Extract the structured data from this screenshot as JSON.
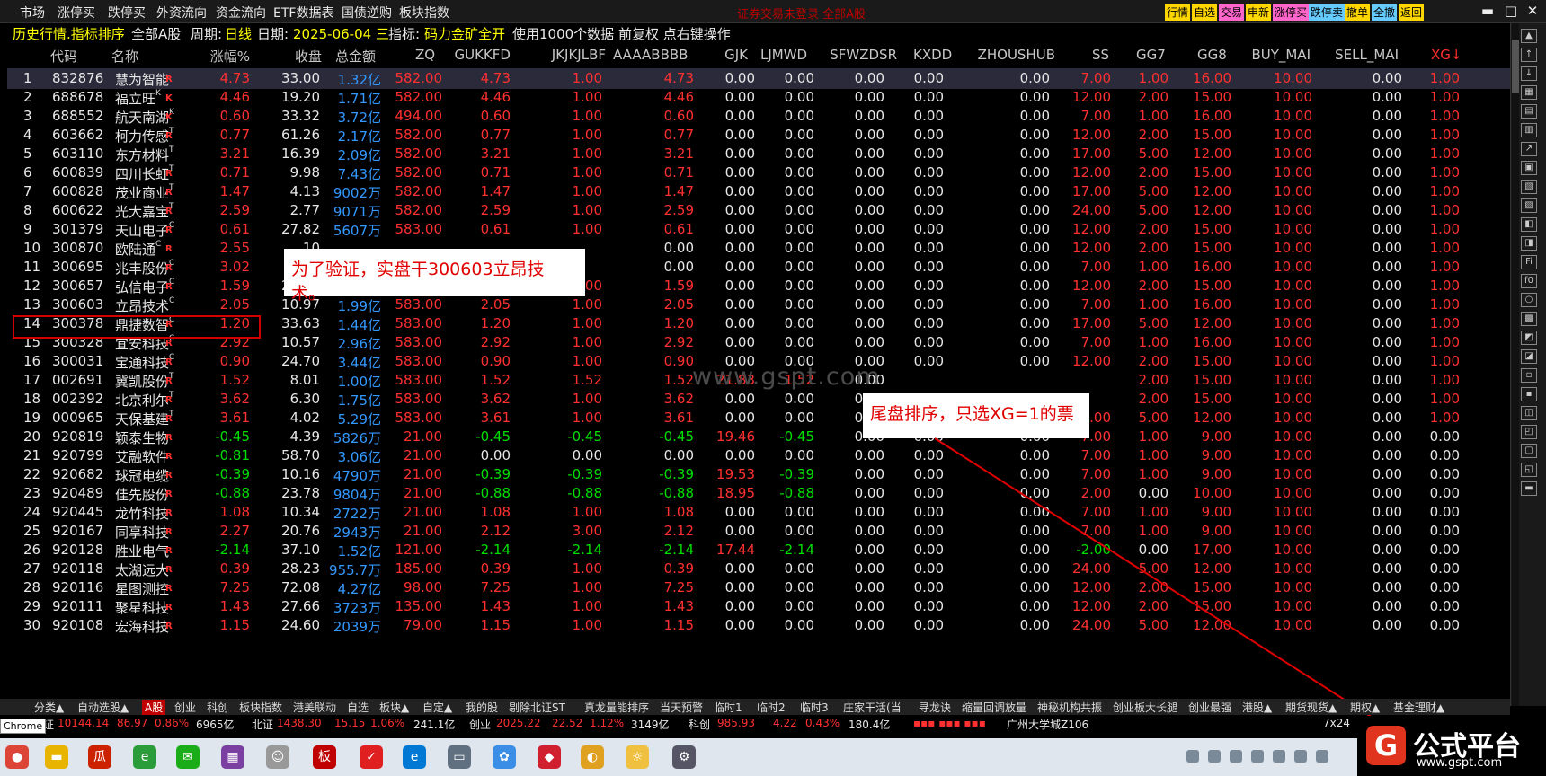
{
  "menu": [
    "市场",
    "涨停买",
    "跌停买",
    "外资流向",
    "资金流向",
    "ETF数据表",
    "国债逆购",
    "板块指数"
  ],
  "warning": "证券交易未登录  全部A股",
  "quick_buttons": [
    {
      "label": "行情",
      "color": "#ffd700"
    },
    {
      "label": "自选",
      "color": "#ffd700"
    },
    {
      "label": "交易",
      "color": "#ff66cc"
    },
    {
      "label": "申新",
      "color": "#ffd700"
    },
    {
      "label": "涨停买",
      "color": "#ff66cc"
    },
    {
      "label": "跌停卖",
      "color": "#66ccff"
    },
    {
      "label": "撤单",
      "color": "#ffd700"
    },
    {
      "label": "全撤",
      "color": "#66ccff"
    },
    {
      "label": "返回",
      "color": "#ffd700"
    }
  ],
  "window_controls": [
    "▬",
    "□",
    "✕"
  ],
  "info": {
    "section": "历史行情.指标排序",
    "market": "全部A股",
    "period_label": "周期:",
    "period": "日线",
    "date_label": "日期:",
    "date": "2025-06-04 三",
    "indicator_label": "指标:",
    "indicator": "码力金矿全开",
    "extra": "使用1000个数据 前复权 点右键操作"
  },
  "columns": [
    "代码",
    "名称",
    "涨幅%",
    "收盘",
    "总金额",
    "ZQ",
    "GUKKFD",
    "JKJKJLBF",
    "AAAABBBB",
    "GJK",
    "LJMWD",
    "SFWZDSR",
    "KXDD",
    "ZHOUSHUB",
    "SS",
    "GG7",
    "GG8",
    "BUY_MAI",
    "SELL_MAI",
    "XG↓"
  ],
  "rows": [
    {
      "n": "1",
      "code": "832876",
      "name": "慧为智能",
      "sup": "",
      "tag": "R",
      "chg": "4.73",
      "close": "33.00",
      "amt": "1.32亿",
      "zq": "582.00",
      "gukkfd": "4.73",
      "jk": "1.00",
      "aa": "4.73",
      "gjk": "0.00",
      "lj": "0.00",
      "sf": "0.00",
      "kx": "0.00",
      "zh": "0.00",
      "ss": "7.00",
      "gg7": "1.00",
      "gg8": "16.00",
      "buy": "10.00",
      "sell": "0.00",
      "xg": "1.00"
    },
    {
      "n": "2",
      "code": "688678",
      "name": "福立旺",
      "sup": "K",
      "tag": "K",
      "chg": "4.46",
      "close": "19.20",
      "amt": "1.71亿",
      "zq": "582.00",
      "gukkfd": "4.46",
      "jk": "1.00",
      "aa": "4.46",
      "gjk": "0.00",
      "lj": "0.00",
      "sf": "0.00",
      "kx": "0.00",
      "zh": "0.00",
      "ss": "12.00",
      "gg7": "2.00",
      "gg8": "15.00",
      "buy": "10.00",
      "sell": "0.00",
      "xg": "1.00"
    },
    {
      "n": "3",
      "code": "688552",
      "name": "航天南湖",
      "sup": "K",
      "tag": "K",
      "chg": "0.60",
      "close": "33.32",
      "amt": "3.72亿",
      "zq": "494.00",
      "gukkfd": "0.60",
      "jk": "1.00",
      "aa": "0.60",
      "gjk": "0.00",
      "lj": "0.00",
      "sf": "0.00",
      "kx": "0.00",
      "zh": "0.00",
      "ss": "7.00",
      "gg7": "1.00",
      "gg8": "16.00",
      "buy": "10.00",
      "sell": "0.00",
      "xg": "1.00"
    },
    {
      "n": "4",
      "code": "603662",
      "name": "柯力传感",
      "sup": "T",
      "tag": "R",
      "chg": "0.77",
      "close": "61.26",
      "amt": "2.17亿",
      "zq": "582.00",
      "gukkfd": "0.77",
      "jk": "1.00",
      "aa": "0.77",
      "gjk": "0.00",
      "lj": "0.00",
      "sf": "0.00",
      "kx": "0.00",
      "zh": "0.00",
      "ss": "12.00",
      "gg7": "2.00",
      "gg8": "15.00",
      "buy": "10.00",
      "sell": "0.00",
      "xg": "1.00"
    },
    {
      "n": "5",
      "code": "603110",
      "name": "东方材料",
      "sup": "T",
      "tag": "",
      "chg": "3.21",
      "close": "16.39",
      "amt": "2.09亿",
      "zq": "582.00",
      "gukkfd": "3.21",
      "jk": "1.00",
      "aa": "3.21",
      "gjk": "0.00",
      "lj": "0.00",
      "sf": "0.00",
      "kx": "0.00",
      "zh": "0.00",
      "ss": "17.00",
      "gg7": "5.00",
      "gg8": "12.00",
      "buy": "10.00",
      "sell": "0.00",
      "xg": "1.00"
    },
    {
      "n": "6",
      "code": "600839",
      "name": "四川长虹",
      "sup": "T",
      "tag": "R",
      "chg": "0.71",
      "close": "9.98",
      "amt": "7.43亿",
      "zq": "582.00",
      "gukkfd": "0.71",
      "jk": "1.00",
      "aa": "0.71",
      "gjk": "0.00",
      "lj": "0.00",
      "sf": "0.00",
      "kx": "0.00",
      "zh": "0.00",
      "ss": "12.00",
      "gg7": "2.00",
      "gg8": "15.00",
      "buy": "10.00",
      "sell": "0.00",
      "xg": "1.00"
    },
    {
      "n": "7",
      "code": "600828",
      "name": "茂业商业",
      "sup": "T",
      "tag": "R",
      "chg": "1.47",
      "close": "4.13",
      "amt": "9002万",
      "zq": "582.00",
      "gukkfd": "1.47",
      "jk": "1.00",
      "aa": "1.47",
      "gjk": "0.00",
      "lj": "0.00",
      "sf": "0.00",
      "kx": "0.00",
      "zh": "0.00",
      "ss": "17.00",
      "gg7": "5.00",
      "gg8": "12.00",
      "buy": "10.00",
      "sell": "0.00",
      "xg": "1.00"
    },
    {
      "n": "8",
      "code": "600622",
      "name": "光大嘉宝",
      "sup": "T",
      "tag": "R",
      "chg": "2.59",
      "close": "2.77",
      "amt": "9071万",
      "zq": "582.00",
      "gukkfd": "2.59",
      "jk": "1.00",
      "aa": "2.59",
      "gjk": "0.00",
      "lj": "0.00",
      "sf": "0.00",
      "kx": "0.00",
      "zh": "0.00",
      "ss": "24.00",
      "gg7": "5.00",
      "gg8": "12.00",
      "buy": "10.00",
      "sell": "0.00",
      "xg": "1.00"
    },
    {
      "n": "9",
      "code": "301379",
      "name": "天山电子",
      "sup": "C",
      "tag": "R",
      "chg": "0.61",
      "close": "27.82",
      "amt": "5607万",
      "zq": "583.00",
      "gukkfd": "0.61",
      "jk": "1.00",
      "aa": "0.61",
      "gjk": "0.00",
      "lj": "0.00",
      "sf": "0.00",
      "kx": "0.00",
      "zh": "0.00",
      "ss": "12.00",
      "gg7": "2.00",
      "gg8": "15.00",
      "buy": "10.00",
      "sell": "0.00",
      "xg": "1.00"
    },
    {
      "n": "10",
      "code": "300870",
      "name": "欧陆通",
      "sup": "C",
      "tag": "R",
      "chg": "2.55",
      "close": "10",
      "amt": "",
      "zq": "",
      "gukkfd": "",
      "jk": "",
      "aa": "0.00",
      "gjk": "0.00",
      "lj": "0.00",
      "sf": "0.00",
      "kx": "0.00",
      "zh": "0.00",
      "ss": "12.00",
      "gg7": "2.00",
      "gg8": "15.00",
      "buy": "10.00",
      "sell": "0.00",
      "xg": "1.00"
    },
    {
      "n": "11",
      "code": "300695",
      "name": "兆丰股份",
      "sup": "C",
      "tag": "R",
      "chg": "3.02",
      "close": "8",
      "amt": "",
      "zq": "",
      "gukkfd": "",
      "jk": "",
      "aa": "0.00",
      "gjk": "0.00",
      "lj": "0.00",
      "sf": "0.00",
      "kx": "0.00",
      "zh": "0.00",
      "ss": "7.00",
      "gg7": "1.00",
      "gg8": "16.00",
      "buy": "10.00",
      "sell": "0.00",
      "xg": "1.00"
    },
    {
      "n": "12",
      "code": "300657",
      "name": "弘信电子",
      "sup": "C",
      "tag": "R",
      "chg": "1.59",
      "close": "25.56",
      "amt": "3.88亿",
      "zq": "583.00",
      "gukkfd": "1.59",
      "jk": "1.00",
      "aa": "1.59",
      "gjk": "0.00",
      "lj": "0.00",
      "sf": "0.00",
      "kx": "0.00",
      "zh": "0.00",
      "ss": "12.00",
      "gg7": "2.00",
      "gg8": "15.00",
      "buy": "10.00",
      "sell": "0.00",
      "xg": "1.00"
    },
    {
      "n": "13",
      "code": "300603",
      "name": "立昂技术",
      "sup": "C",
      "tag": "",
      "chg": "2.05",
      "close": "10.97",
      "amt": "1.99亿",
      "zq": "583.00",
      "gukkfd": "2.05",
      "jk": "1.00",
      "aa": "2.05",
      "gjk": "0.00",
      "lj": "0.00",
      "sf": "0.00",
      "kx": "0.00",
      "zh": "0.00",
      "ss": "7.00",
      "gg7": "1.00",
      "gg8": "16.00",
      "buy": "10.00",
      "sell": "0.00",
      "xg": "1.00"
    },
    {
      "n": "14",
      "code": "300378",
      "name": "鼎捷数智",
      "sup": "C",
      "tag": "R",
      "chg": "1.20",
      "close": "33.63",
      "amt": "1.44亿",
      "zq": "583.00",
      "gukkfd": "1.20",
      "jk": "1.00",
      "aa": "1.20",
      "gjk": "0.00",
      "lj": "0.00",
      "sf": "0.00",
      "kx": "0.00",
      "zh": "0.00",
      "ss": "17.00",
      "gg7": "5.00",
      "gg8": "12.00",
      "buy": "10.00",
      "sell": "0.00",
      "xg": "1.00"
    },
    {
      "n": "15",
      "code": "300328",
      "name": "宜安科技",
      "sup": "C",
      "tag": "R",
      "chg": "2.92",
      "close": "10.57",
      "amt": "2.96亿",
      "zq": "583.00",
      "gukkfd": "2.92",
      "jk": "1.00",
      "aa": "2.92",
      "gjk": "0.00",
      "lj": "0.00",
      "sf": "0.00",
      "kx": "0.00",
      "zh": "0.00",
      "ss": "7.00",
      "gg7": "1.00",
      "gg8": "16.00",
      "buy": "10.00",
      "sell": "0.00",
      "xg": "1.00"
    },
    {
      "n": "16",
      "code": "300031",
      "name": "宝通科技",
      "sup": "C",
      "tag": "R",
      "chg": "0.90",
      "close": "24.70",
      "amt": "3.44亿",
      "zq": "583.00",
      "gukkfd": "0.90",
      "jk": "1.00",
      "aa": "0.90",
      "gjk": "0.00",
      "lj": "0.00",
      "sf": "0.00",
      "kx": "0.00",
      "zh": "0.00",
      "ss": "12.00",
      "gg7": "2.00",
      "gg8": "15.00",
      "buy": "10.00",
      "sell": "0.00",
      "xg": "1.00"
    },
    {
      "n": "17",
      "code": "002691",
      "name": "冀凯股份",
      "sup": "T",
      "tag": "R",
      "chg": "1.52",
      "close": "8.01",
      "amt": "1.00亿",
      "zq": "583.00",
      "gukkfd": "1.52",
      "jk": "1.52",
      "aa": "1.52",
      "gjk": "21.83",
      "lj": "1.52",
      "sf": "0.00",
      "kx": "",
      "zh": "",
      "ss": "",
      "gg7": "2.00",
      "gg8": "15.00",
      "buy": "10.00",
      "sell": "0.00",
      "xg": "1.00"
    },
    {
      "n": "18",
      "code": "002392",
      "name": "北京利尔",
      "sup": "T",
      "tag": "R",
      "chg": "3.62",
      "close": "6.30",
      "amt": "1.75亿",
      "zq": "583.00",
      "gukkfd": "3.62",
      "jk": "1.00",
      "aa": "3.62",
      "gjk": "0.00",
      "lj": "0.00",
      "sf": "0.00",
      "kx": "",
      "zh": "",
      "ss": "",
      "gg7": "2.00",
      "gg8": "15.00",
      "buy": "10.00",
      "sell": "0.00",
      "xg": "1.00"
    },
    {
      "n": "19",
      "code": "000965",
      "name": "天保基建",
      "sup": "T",
      "tag": "R",
      "chg": "3.61",
      "close": "4.02",
      "amt": "5.29亿",
      "zq": "583.00",
      "gukkfd": "3.61",
      "jk": "1.00",
      "aa": "3.61",
      "gjk": "0.00",
      "lj": "0.00",
      "sf": "0.00",
      "kx": "0.00",
      "zh": "0.00",
      "ss": "19.00",
      "gg7": "5.00",
      "gg8": "12.00",
      "buy": "10.00",
      "sell": "0.00",
      "xg": "1.00"
    },
    {
      "n": "20",
      "code": "920819",
      "name": "颖泰生物",
      "sup": "",
      "tag": "R",
      "chg": "-0.45",
      "close": "4.39",
      "amt": "5826万",
      "zq": "21.00",
      "gukkfd": "-0.45",
      "jk": "-0.45",
      "aa": "-0.45",
      "gjk": "19.46",
      "lj": "-0.45",
      "sf": "0.00",
      "kx": "0.00",
      "zh": "0.00",
      "ss": "7.00",
      "gg7": "1.00",
      "gg8": "9.00",
      "buy": "10.00",
      "sell": "0.00",
      "xg": "0.00"
    },
    {
      "n": "21",
      "code": "920799",
      "name": "艾融软件",
      "sup": "",
      "tag": "R",
      "chg": "-0.81",
      "close": "58.70",
      "amt": "3.06亿",
      "zq": "21.00",
      "gukkfd": "0.00",
      "jk": "0.00",
      "aa": "0.00",
      "gjk": "0.00",
      "lj": "0.00",
      "sf": "0.00",
      "kx": "0.00",
      "zh": "0.00",
      "ss": "7.00",
      "gg7": "1.00",
      "gg8": "9.00",
      "buy": "10.00",
      "sell": "0.00",
      "xg": "0.00"
    },
    {
      "n": "22",
      "code": "920682",
      "name": "球冠电缆",
      "sup": "",
      "tag": "R",
      "chg": "-0.39",
      "close": "10.16",
      "amt": "4790万",
      "zq": "21.00",
      "gukkfd": "-0.39",
      "jk": "-0.39",
      "aa": "-0.39",
      "gjk": "19.53",
      "lj": "-0.39",
      "sf": "0.00",
      "kx": "0.00",
      "zh": "0.00",
      "ss": "7.00",
      "gg7": "1.00",
      "gg8": "9.00",
      "buy": "10.00",
      "sell": "0.00",
      "xg": "0.00"
    },
    {
      "n": "23",
      "code": "920489",
      "name": "佳先股份",
      "sup": "",
      "tag": "R",
      "chg": "-0.88",
      "close": "23.78",
      "amt": "9804万",
      "zq": "21.00",
      "gukkfd": "-0.88",
      "jk": "-0.88",
      "aa": "-0.88",
      "gjk": "18.95",
      "lj": "-0.88",
      "sf": "0.00",
      "kx": "0.00",
      "zh": "0.00",
      "ss": "2.00",
      "gg7": "0.00",
      "gg8": "10.00",
      "buy": "10.00",
      "sell": "0.00",
      "xg": "0.00"
    },
    {
      "n": "24",
      "code": "920445",
      "name": "龙竹科技",
      "sup": "",
      "tag": "R",
      "chg": "1.08",
      "close": "10.34",
      "amt": "2722万",
      "zq": "21.00",
      "gukkfd": "1.08",
      "jk": "1.00",
      "aa": "1.08",
      "gjk": "0.00",
      "lj": "0.00",
      "sf": "0.00",
      "kx": "0.00",
      "zh": "0.00",
      "ss": "7.00",
      "gg7": "1.00",
      "gg8": "9.00",
      "buy": "10.00",
      "sell": "0.00",
      "xg": "0.00"
    },
    {
      "n": "25",
      "code": "920167",
      "name": "同享科技",
      "sup": "",
      "tag": "R",
      "chg": "2.27",
      "close": "20.76",
      "amt": "2943万",
      "zq": "21.00",
      "gukkfd": "2.12",
      "jk": "3.00",
      "aa": "2.12",
      "gjk": "0.00",
      "lj": "0.00",
      "sf": "0.00",
      "kx": "0.00",
      "zh": "0.00",
      "ss": "7.00",
      "gg7": "1.00",
      "gg8": "9.00",
      "buy": "10.00",
      "sell": "0.00",
      "xg": "0.00"
    },
    {
      "n": "26",
      "code": "920128",
      "name": "胜业电气",
      "sup": "",
      "tag": "R",
      "chg": "-2.14",
      "close": "37.10",
      "amt": "1.52亿",
      "zq": "121.00",
      "gukkfd": "-2.14",
      "jk": "-2.14",
      "aa": "-2.14",
      "gjk": "17.44",
      "lj": "-2.14",
      "sf": "0.00",
      "kx": "0.00",
      "zh": "0.00",
      "ss": "-2.00",
      "gg7": "0.00",
      "gg8": "17.00",
      "buy": "10.00",
      "sell": "0.00",
      "xg": "0.00"
    },
    {
      "n": "27",
      "code": "920118",
      "name": "太湖远大",
      "sup": "",
      "tag": "R",
      "chg": "0.39",
      "close": "28.23",
      "amt": "955.7万",
      "zq": "185.00",
      "gukkfd": "0.39",
      "jk": "1.00",
      "aa": "0.39",
      "gjk": "0.00",
      "lj": "0.00",
      "sf": "0.00",
      "kx": "0.00",
      "zh": "0.00",
      "ss": "24.00",
      "gg7": "5.00",
      "gg8": "12.00",
      "buy": "10.00",
      "sell": "0.00",
      "xg": "0.00"
    },
    {
      "n": "28",
      "code": "920116",
      "name": "星图测控",
      "sup": "",
      "tag": "R",
      "chg": "7.25",
      "close": "72.08",
      "amt": "4.27亿",
      "zq": "98.00",
      "gukkfd": "7.25",
      "jk": "1.00",
      "aa": "7.25",
      "gjk": "0.00",
      "lj": "0.00",
      "sf": "0.00",
      "kx": "0.00",
      "zh": "0.00",
      "ss": "12.00",
      "gg7": "2.00",
      "gg8": "15.00",
      "buy": "10.00",
      "sell": "0.00",
      "xg": "0.00"
    },
    {
      "n": "29",
      "code": "920111",
      "name": "聚星科技",
      "sup": "",
      "tag": "R",
      "chg": "1.43",
      "close": "27.66",
      "amt": "3723万",
      "zq": "135.00",
      "gukkfd": "1.43",
      "jk": "1.00",
      "aa": "1.43",
      "gjk": "0.00",
      "lj": "0.00",
      "sf": "0.00",
      "kx": "0.00",
      "zh": "0.00",
      "ss": "12.00",
      "gg7": "2.00",
      "gg8": "15.00",
      "buy": "10.00",
      "sell": "0.00",
      "xg": "0.00"
    },
    {
      "n": "30",
      "code": "920108",
      "name": "宏海科技",
      "sup": "",
      "tag": "R",
      "chg": "1.15",
      "close": "24.60",
      "amt": "2039万",
      "zq": "79.00",
      "gukkfd": "1.15",
      "jk": "1.00",
      "aa": "1.15",
      "gjk": "0.00",
      "lj": "0.00",
      "sf": "0.00",
      "kx": "0.00",
      "zh": "0.00",
      "ss": "24.00",
      "gg7": "5.00",
      "gg8": "12.00",
      "buy": "10.00",
      "sell": "0.00",
      "xg": "0.00"
    }
  ],
  "annotations": {
    "verify": "为了验证，实盘干300603立昂技术。",
    "sort": "尾盘排序，只选XG=1的票",
    "watermark": "www.gspt.com"
  },
  "tabs": [
    "分类▲",
    "自动选股▲",
    "A股",
    "创业",
    "科创",
    "板块指数",
    "港美联动",
    "自选",
    "板块▲",
    "自定▲",
    "我的股",
    "剔除北证ST",
    "真龙量能排序",
    "当天预警",
    "临时1",
    "临时2",
    "临时3",
    "庄家干活(当",
    "寻龙诀",
    "缩量回调放量",
    "神秘机构共振",
    "创业板大长腿",
    "创业最强",
    "港股▲",
    "期货现货▲",
    "期权▲",
    "基金理财▲"
  ],
  "status": {
    "sh_label": "深证",
    "sh_val": "10144.14",
    "sh_chg": "86.97",
    "sh_pct": "0.86%",
    "sh_amt": "6965亿",
    "bz_label": "北证",
    "bz_val": "1438.30",
    "bz_chg": "15.15",
    "bz_pct": "1.06%",
    "bz_amt": "241.1亿",
    "cy_label": "创业",
    "cy_val": "2025.22",
    "cy_chg": "22.52",
    "cy_pct": "1.12%",
    "cy_amt": "3149亿",
    "kc_label": "科创",
    "kc_val": "985.93",
    "kc_chg": "4.22",
    "kc_pct": "0.43%",
    "kc_amt": "180.4亿",
    "location": "广州大学城Z106",
    "time": "7x24"
  },
  "chrome_tip": "Chrome",
  "logo": {
    "letter": "G",
    "text": "公式平台",
    "url": "www.gspt.com"
  }
}
